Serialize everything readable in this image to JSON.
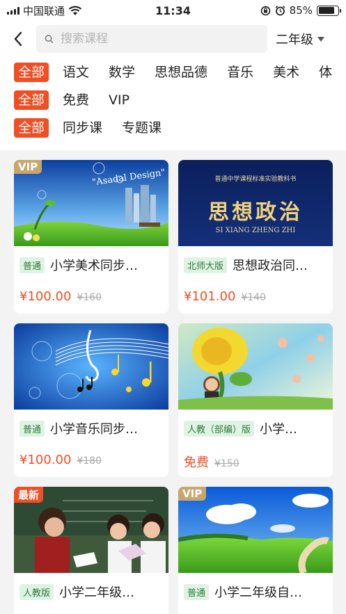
{
  "status": {
    "carrier": "中国联通",
    "time": "11:34",
    "battery": "85%",
    "battery_level": 0.85
  },
  "header": {
    "search_placeholder": "搜索课程",
    "grade": "二年级"
  },
  "filters": {
    "subjects": [
      "全部",
      "语文",
      "数学",
      "思想品德",
      "音乐",
      "美术",
      "体"
    ],
    "price": [
      "全部",
      "免费",
      "VIP"
    ],
    "types": [
      "全部",
      "同步课",
      "专题课"
    ]
  },
  "courses": [
    {
      "badge": "VIP",
      "edition": "普通",
      "title": "小学美术同步…",
      "price": "¥100.00",
      "original_price": "¥160",
      "thumb_text": "\"Asadal Design\""
    },
    {
      "badge": "",
      "edition": "北师大版",
      "title": "思想政治同…",
      "price": "¥101.00",
      "original_price": "¥140",
      "thumb_top": "普通中学课程标准实验教科书",
      "thumb_main": "思想政治",
      "thumb_sub": "SI XIANG ZHENG ZHI"
    },
    {
      "badge": "",
      "edition": "普通",
      "title": "小学音乐同步…",
      "price": "¥100.00",
      "original_price": "¥180"
    },
    {
      "badge": "",
      "edition": "人教（部编）版",
      "title": "小学…",
      "price": "免费",
      "original_price": "¥150"
    },
    {
      "badge": "最新",
      "edition": "人教版",
      "title": "小学二年级…",
      "price": "",
      "original_price": ""
    },
    {
      "badge": "VIP",
      "edition": "普通",
      "title": "小学二年级自…",
      "price": "",
      "original_price": ""
    }
  ],
  "colors": {
    "accent": "#f04e23",
    "vip_badge": "#c9a66b",
    "edition_bg": "#dff3e3"
  }
}
